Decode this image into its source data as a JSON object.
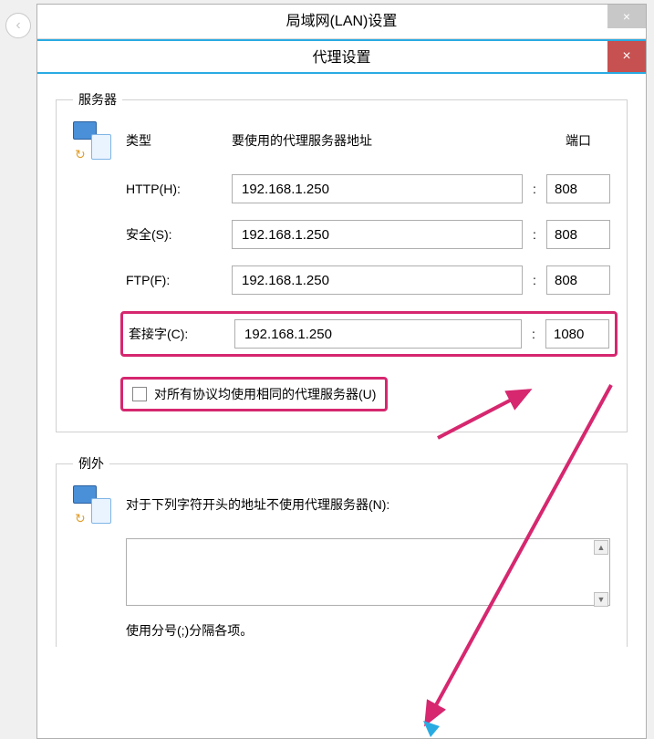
{
  "outer": {
    "title": "局域网(LAN)设置",
    "close": "×"
  },
  "inner": {
    "title": "代理设置",
    "close": "×"
  },
  "server": {
    "legend": "服务器",
    "headers": {
      "type": "类型",
      "address": "要使用的代理服务器地址",
      "port": "端口"
    },
    "proxies": [
      {
        "label": "HTTP(H):",
        "addr": "192.168.1.250",
        "port": "808"
      },
      {
        "label": "安全(S):",
        "addr": "192.168.1.250",
        "port": "808"
      },
      {
        "label": "FTP(F):",
        "addr": "192.168.1.250",
        "port": "808"
      },
      {
        "label": "套接字(C):",
        "addr": "192.168.1.250",
        "port": "1080"
      }
    ],
    "same_checkbox": "对所有协议均使用相同的代理服务器(U)"
  },
  "exceptions": {
    "legend": "例外",
    "label": "对于下列字符开头的地址不使用代理服务器(N):",
    "value": "",
    "hint": "使用分号(;)分隔各项。"
  }
}
